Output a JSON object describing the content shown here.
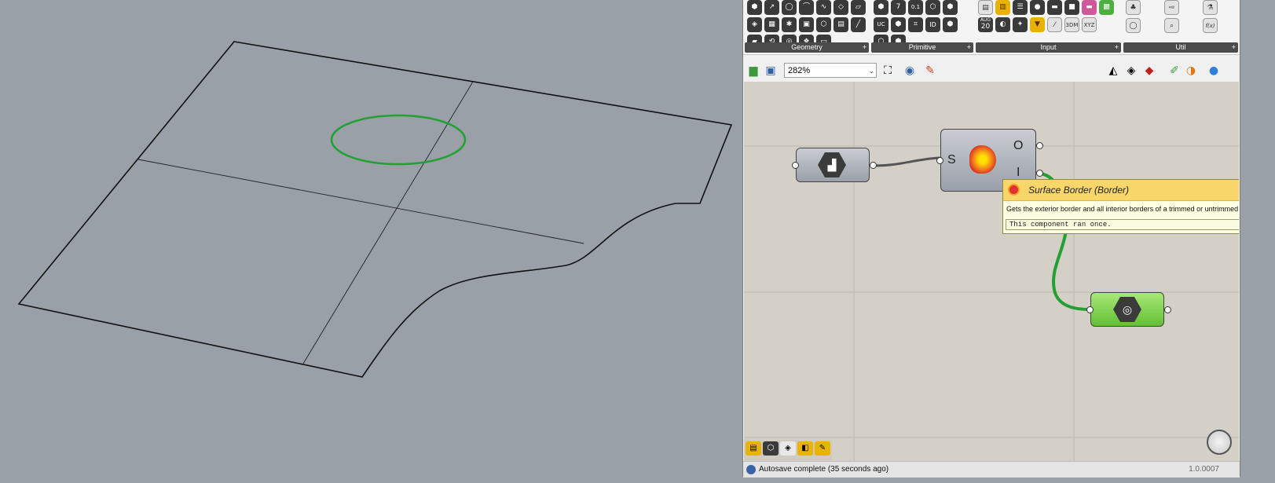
{
  "ribbon": {
    "panels": [
      {
        "label": "Geometry"
      },
      {
        "label": "Primitive"
      },
      {
        "label": "Input"
      },
      {
        "label": "Util"
      }
    ],
    "icon_labels": {
      "seven": "7",
      "pi": "0.1",
      "id": "ID",
      "uc": "UC",
      "num20_top": "AUG",
      "num20": "20",
      "threedm": "3DM",
      "xyz": "XYZ",
      "fx": "f(x)"
    }
  },
  "toolbar": {
    "zoom_value": "282%"
  },
  "canvas": {
    "source_component": {
      "icon": "surface-param-icon"
    },
    "border_component": {
      "icon": "surface-border-icon",
      "input_label": "S",
      "output_labels": [
        "O",
        "I"
      ]
    },
    "result_component": {
      "icon": "curve-param-icon"
    }
  },
  "tooltip": {
    "title": "Surface Border (Border)",
    "description": "Gets the exterior border and all interior borders of a trimmed or untrimmed surface.",
    "status": "This component ran once."
  },
  "status_bar": {
    "message": "Autosave complete (35 seconds ago)",
    "version": "1.0.0007"
  },
  "colors": {
    "viewport_bg": "#99a0a8",
    "canvas_bg": "#d4d0c8",
    "wire_green": "#22a032",
    "tooltip_header": "#f8d66a"
  }
}
